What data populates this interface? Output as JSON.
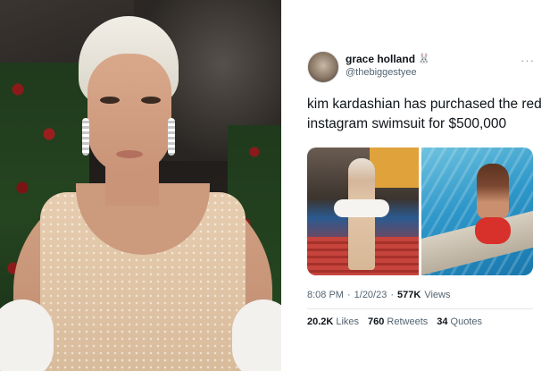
{
  "tweet": {
    "display_name": "grace holland",
    "name_emoji": "🐰",
    "handle": "@thebiggestyee",
    "more_icon": "more-horizontal-icon",
    "text": "kim kardashian has purchased the red instagram swimsuit for $500,000",
    "time": "8:08 PM",
    "sep1": "·",
    "date": "1/20/23",
    "sep2": "·",
    "views_count": "577K",
    "views_label": "Views",
    "likes_count": "20.2K",
    "likes_label": "Likes",
    "retweets_count": "760",
    "retweets_label": "Retweets",
    "quotes_count": "34",
    "quotes_label": "Quotes"
  },
  "colors": {
    "text_primary": "#0f1419",
    "text_secondary": "#536471",
    "divider": "#e6e6e6"
  }
}
